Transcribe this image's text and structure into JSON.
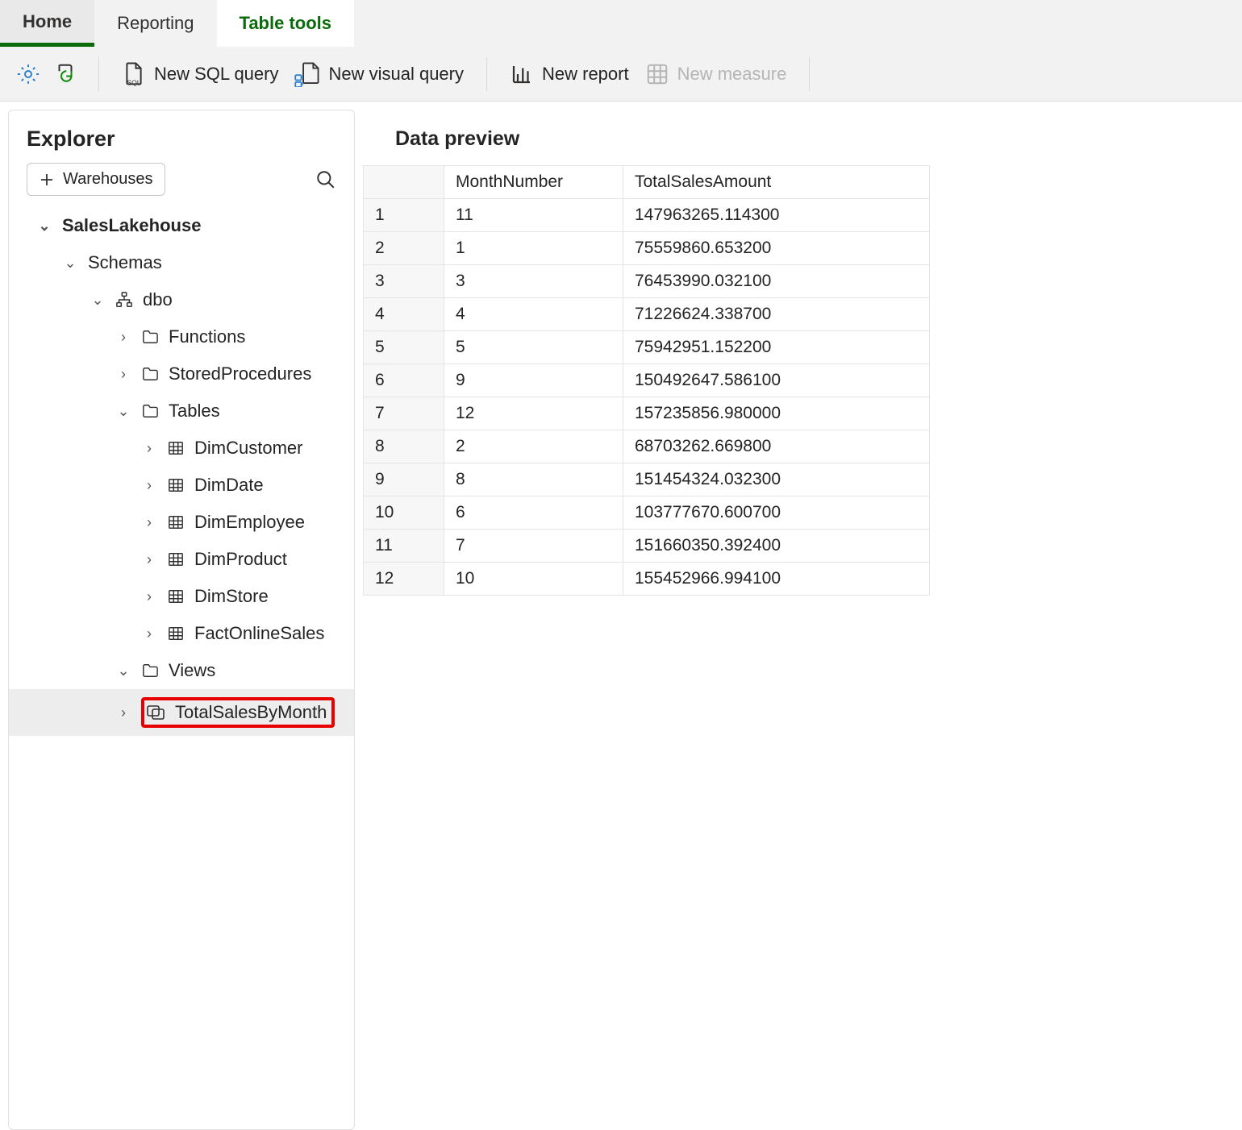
{
  "tabs": {
    "home": "Home",
    "reporting": "Reporting",
    "table_tools": "Table tools"
  },
  "toolbar": {
    "new_sql": "New SQL query",
    "new_visual": "New visual query",
    "new_report": "New report",
    "new_measure": "New measure"
  },
  "explorer": {
    "title": "Explorer",
    "warehouses_btn": "Warehouses",
    "root": "SalesLakehouse",
    "schemas": "Schemas",
    "schema_name": "dbo",
    "folders": {
      "functions": "Functions",
      "sp": "StoredProcedures",
      "tables": "Tables",
      "views": "Views"
    },
    "tables": [
      "DimCustomer",
      "DimDate",
      "DimEmployee",
      "DimProduct",
      "DimStore",
      "FactOnlineSales"
    ],
    "views": [
      "TotalSalesByMonth"
    ]
  },
  "preview": {
    "title": "Data preview",
    "columns": [
      "MonthNumber",
      "TotalSalesAmount"
    ],
    "rows": [
      {
        "n": "1",
        "MonthNumber": "11",
        "TotalSalesAmount": "147963265.114300"
      },
      {
        "n": "2",
        "MonthNumber": "1",
        "TotalSalesAmount": "75559860.653200"
      },
      {
        "n": "3",
        "MonthNumber": "3",
        "TotalSalesAmount": "76453990.032100"
      },
      {
        "n": "4",
        "MonthNumber": "4",
        "TotalSalesAmount": "71226624.338700"
      },
      {
        "n": "5",
        "MonthNumber": "5",
        "TotalSalesAmount": "75942951.152200"
      },
      {
        "n": "6",
        "MonthNumber": "9",
        "TotalSalesAmount": "150492647.586100"
      },
      {
        "n": "7",
        "MonthNumber": "12",
        "TotalSalesAmount": "157235856.980000"
      },
      {
        "n": "8",
        "MonthNumber": "2",
        "TotalSalesAmount": "68703262.669800"
      },
      {
        "n": "9",
        "MonthNumber": "8",
        "TotalSalesAmount": "151454324.032300"
      },
      {
        "n": "10",
        "MonthNumber": "6",
        "TotalSalesAmount": "103777670.600700"
      },
      {
        "n": "11",
        "MonthNumber": "7",
        "TotalSalesAmount": "151660350.392400"
      },
      {
        "n": "12",
        "MonthNumber": "10",
        "TotalSalesAmount": "155452966.994100"
      }
    ]
  }
}
